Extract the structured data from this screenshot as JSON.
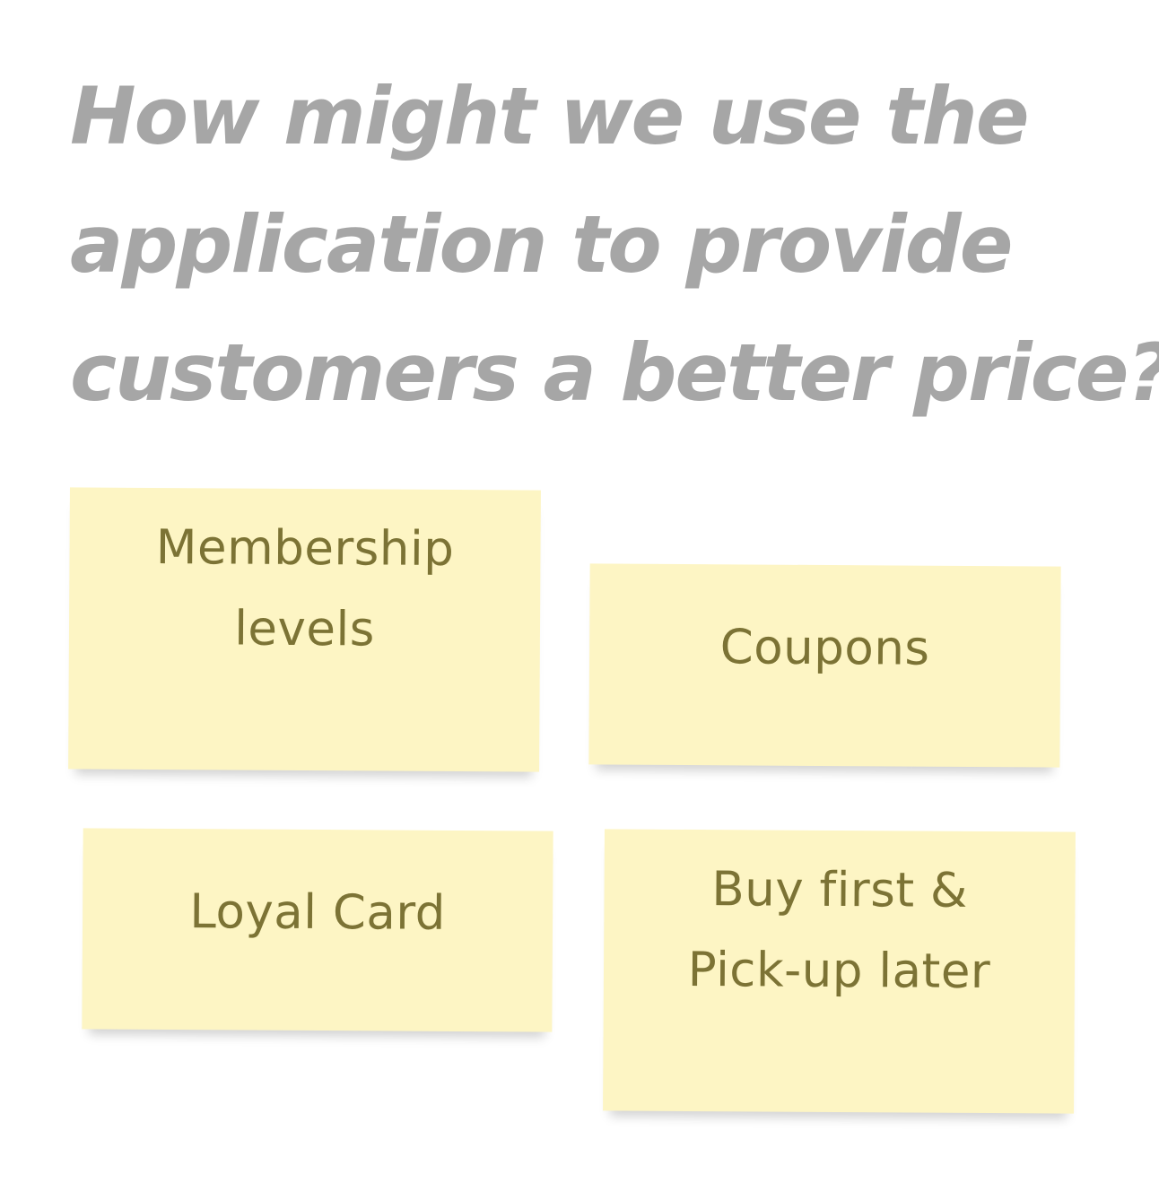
{
  "question": {
    "lines": [
      "How might we use the",
      "application to provide",
      "customers a better price?"
    ]
  },
  "notes": [
    {
      "lines": [
        "Membership",
        "levels"
      ]
    },
    {
      "lines": [
        "Coupons"
      ]
    },
    {
      "lines": [
        "Loyal Card"
      ]
    },
    {
      "lines": [
        "Buy first &",
        "Pick-up later"
      ]
    }
  ],
  "colors": {
    "question_text": "#a6a6a6",
    "note_background": "#fdf5c4",
    "note_text": "#7c7335"
  }
}
